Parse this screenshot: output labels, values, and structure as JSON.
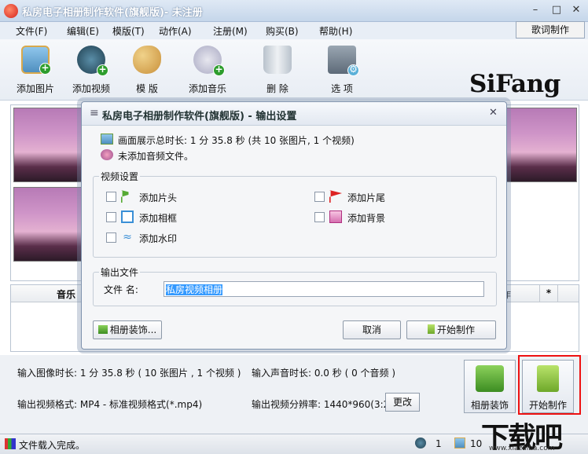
{
  "window": {
    "title": "私房电子相册制作软件(旗舰版)- 未注册"
  },
  "menu": {
    "items": [
      "文件(F)",
      "编辑(E)",
      "模版(T)",
      "动作(A)",
      "注册(M)",
      "购买(B)",
      "帮助(H)"
    ],
    "right_button": "歌词制作"
  },
  "toolbar": {
    "items": [
      {
        "label": "添加图片",
        "icon": "add-picture-icon"
      },
      {
        "label": "添加视频",
        "icon": "add-video-icon"
      },
      {
        "label": "模 版",
        "icon": "template-palette-icon"
      },
      {
        "label": "添加音乐",
        "icon": "add-music-icon"
      },
      {
        "label": "删 除",
        "icon": "recycle-bin-icon"
      },
      {
        "label": "选 项",
        "icon": "options-icon"
      }
    ],
    "logo": "SiFang"
  },
  "list": {
    "col_music": "音乐",
    "col_action": "作",
    "col_star": "*"
  },
  "dialog": {
    "title": "私房电子相册制作软件(旗舰版) - 输出设置",
    "summary": "画面展示总时长: 1 分 35.8 秒 (共 10 张图片, 1 个视频)",
    "audio_note": "未添加音频文件。",
    "video_settings": {
      "label": "视频设置",
      "options": [
        {
          "label": "添加片头",
          "checked": false,
          "icon": "flag-green-icon"
        },
        {
          "label": "添加片尾",
          "checked": false,
          "icon": "flag-red-icon"
        },
        {
          "label": "添加相框",
          "checked": false,
          "icon": "frame-icon"
        },
        {
          "label": "添加背景",
          "checked": false,
          "icon": "background-icon"
        },
        {
          "label": "添加水印",
          "checked": false,
          "icon": "watermark-icon"
        }
      ]
    },
    "output_file": {
      "label": "输出文件",
      "filename_label": "文件 名:",
      "filename_value": "私房视频相册"
    },
    "buttons": {
      "decorate": "相册装饰...",
      "cancel": "取消",
      "start": "开始制作"
    }
  },
  "bottom": {
    "input_image_duration": "输入图像时长: 1 分 35.8 秒 ( 10 张图片 , 1 个视频 )",
    "input_audio_duration": "输入声音时长: 0.0 秒 ( 0 个音频 )",
    "output_format": "输出视频格式: MP4 - 标准视频格式(*.mp4)",
    "output_resolution": "输出视频分辨率: 1440*960(3:2)",
    "change_button": "更改",
    "decorate_button": "相册装饰",
    "start_button": "开始制作"
  },
  "status": {
    "text": "文件载入完成。",
    "video_count": "1",
    "image_count": "10"
  },
  "watermark": {
    "text": "下载吧",
    "url_text": "www.xiazaiba.com"
  },
  "colors": {
    "highlight": "#ee1111",
    "selection": "#3399ff",
    "logo_a": "#d81c1c"
  }
}
